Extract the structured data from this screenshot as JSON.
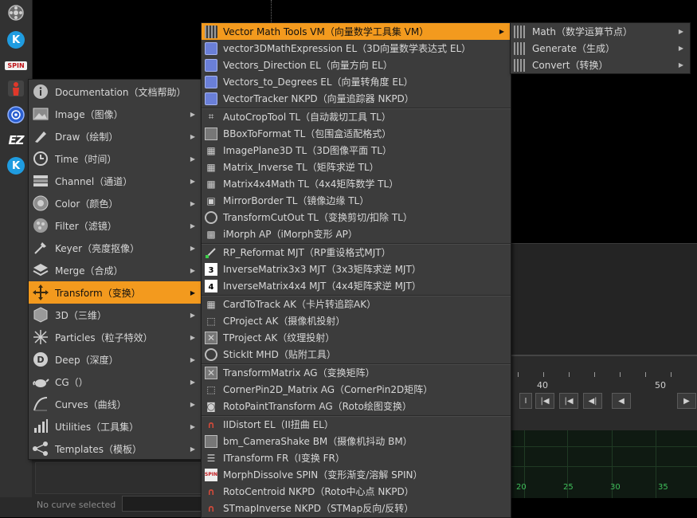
{
  "toolbar": {
    "spin_label": "SPIN",
    "ez_label": "EZ",
    "k_label": "K"
  },
  "main_menu": {
    "items": [
      {
        "label": "Documentation（文档帮助）",
        "icon": "info-icon",
        "submenu": false
      },
      {
        "label": "Image（图像）",
        "icon": "image-icon",
        "submenu": true
      },
      {
        "label": "Draw（绘制）",
        "icon": "brush-icon",
        "submenu": true
      },
      {
        "label": "Time（时间）",
        "icon": "clock-icon",
        "submenu": true
      },
      {
        "label": "Channel（通道）",
        "icon": "channel-icon",
        "submenu": true
      },
      {
        "label": "Color（颜色）",
        "icon": "color-wheel-icon",
        "submenu": true
      },
      {
        "label": "Filter（滤镜）",
        "icon": "filter-icon",
        "submenu": true
      },
      {
        "label": "Keyer（亮度抠像）",
        "icon": "keyer-icon",
        "submenu": true
      },
      {
        "label": "Merge（合成）",
        "icon": "layers-icon",
        "submenu": true
      },
      {
        "label": "Transform（变换）",
        "icon": "transform-icon",
        "submenu": true
      },
      {
        "label": "3D（三维）",
        "icon": "cube-icon",
        "submenu": true
      },
      {
        "label": "Particles（粒子特效）",
        "icon": "particles-icon",
        "submenu": true
      },
      {
        "label": "Deep（深度）",
        "icon": "deep-icon",
        "submenu": true
      },
      {
        "label": "CG（）",
        "icon": "teapot-icon",
        "submenu": true
      },
      {
        "label": "Curves（曲线）",
        "icon": "curves-icon",
        "submenu": true
      },
      {
        "label": "Utilities（工具集）",
        "icon": "wrench-icon",
        "submenu": true
      },
      {
        "label": "Templates（模板）",
        "icon": "templates-icon",
        "submenu": true
      }
    ],
    "highlighted_index": 9
  },
  "transform_menu": {
    "items": [
      {
        "label": "Vector Math Tools VM（向量数学工具集 VM）",
        "icon": "grid-icon",
        "submenu": true
      },
      {
        "label": "vector3DMathExpression EL（3D向量数学表达式 EL）",
        "icon": "node-icon"
      },
      {
        "label": "Vectors_Direction EL（向量方向 EL）",
        "icon": "node-icon"
      },
      {
        "label": "Vectors_to_Degrees EL（向量转角度 EL）",
        "icon": "node-icon"
      },
      {
        "label": "VectorTracker NKPD（向量追踪器 NKPD）",
        "icon": "node-icon"
      },
      {
        "label": "AutoCropTool TL（自动裁切工具 TL）",
        "icon": "crop-icon"
      },
      {
        "label": "BBoxToFormat TL（包围盒适配格式）",
        "icon": "box-icon"
      },
      {
        "label": "ImagePlane3D TL（3D图像平面 TL）",
        "icon": "plane-icon"
      },
      {
        "label": "Matrix_Inverse TL（矩阵求逆 TL）",
        "icon": "matrix-icon"
      },
      {
        "label": "Matrix4x4Math TL（4x4矩阵数学 TL）",
        "icon": "matrix-icon"
      },
      {
        "label": "MirrorBorder TL（镜像边缘 TL）",
        "icon": "mirror-icon"
      },
      {
        "label": "TransformCutOut TL（变换剪切/扣除 TL）",
        "icon": "circle-icon"
      },
      {
        "label": "iMorph AP（iMorph变形 AP）",
        "icon": "morph-icon"
      },
      {
        "label": "RP_Reformat MJT（RP重设格式MJT）",
        "icon": "reformat-icon"
      },
      {
        "label": "InverseMatrix3x3 MJT（3x3矩阵求逆 MJT）",
        "icon": "matrix3-icon"
      },
      {
        "label": "InverseMatrix4x4 MJT（4x4矩阵求逆 MJT）",
        "icon": "matrix4-icon"
      },
      {
        "label": "CardToTrack AK（卡片转追踪AK）",
        "icon": "card-icon"
      },
      {
        "label": "CProject AK（摄像机投射）",
        "icon": "project-icon"
      },
      {
        "label": "TProject AK（纹理投射）",
        "icon": "texture-icon"
      },
      {
        "label": "StickIt MHD（贴附工具）",
        "icon": "clock-icon"
      },
      {
        "label": "TransformMatrix AG（变换矩阵）",
        "icon": "texture-icon"
      },
      {
        "label": "CornerPin2D_Matrix AG（CornerPin2D矩阵）",
        "icon": "cornerpin-icon"
      },
      {
        "label": "RotoPaintTransform AG（Roto绘图变换）",
        "icon": "roto-icon"
      },
      {
        "label": "IIDistort EL（II扭曲 EL）",
        "icon": "distort-icon"
      },
      {
        "label": "bm_CameraShake BM（摄像机抖动 BM）",
        "icon": "camera-icon"
      },
      {
        "label": "ITransform FR（I变换 FR）",
        "icon": "itransform-icon"
      },
      {
        "label": "MorphDissolve SPIN（变形渐变/溶解 SPIN）",
        "icon": "spin-icon"
      },
      {
        "label": "RotoCentroid NKPD（Roto中心点 NKPD）",
        "icon": "distort-icon"
      },
      {
        "label": "STmapInverse NKPD（STMap反向/反转）",
        "icon": "distort-icon"
      }
    ],
    "highlighted_index": 0
  },
  "vector_menu": {
    "items": [
      {
        "label": "Math（数学运算节点）",
        "icon": "grid-icon"
      },
      {
        "label": "Generate（生成）",
        "icon": "grid-icon"
      },
      {
        "label": "Convert（转换）",
        "icon": "grid-icon"
      }
    ]
  },
  "timeline": {
    "tick_labels": [
      "40",
      "50"
    ],
    "frame_value": "1",
    "curve_numbers": [
      "20",
      "25",
      "30",
      "35"
    ]
  },
  "curve_editor": {
    "status": "No curve selected"
  }
}
